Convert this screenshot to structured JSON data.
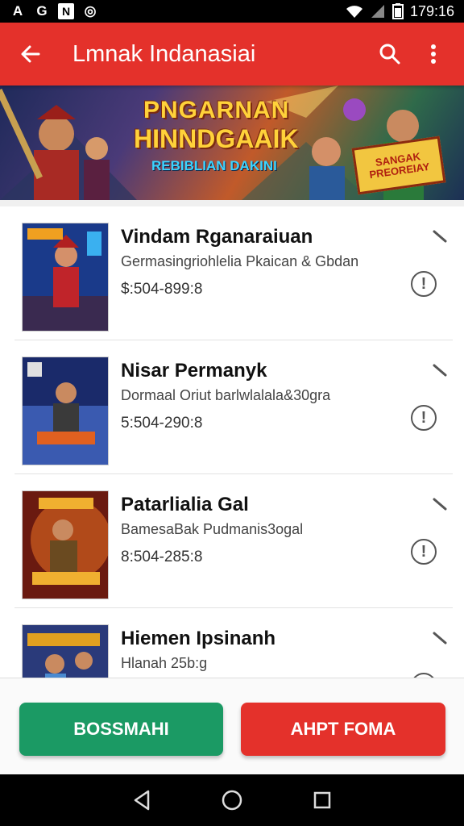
{
  "status_bar": {
    "left_icons": [
      "A",
      "G",
      "N",
      "◎"
    ],
    "time": "179:16"
  },
  "app_bar": {
    "title": "Lmnak Indanasiai",
    "icons": [
      "back-arrow-icon",
      "search-icon",
      "more-vert-icon"
    ]
  },
  "banner": {
    "line1": "PNGARNAN",
    "line2": "HINNDGAAIK",
    "line3": "REBIBLIAN DAKINI",
    "badge_line1": "SANGAK",
    "badge_line2": "PREOREIAY"
  },
  "games": [
    {
      "name": "Vindam Rganaraiuan",
      "subtitle": "Germasingriohlelia Pkaican & Gbdan",
      "meta": "$:504-899:8",
      "thumb_colors": [
        "#1a3a8a",
        "#c0242a",
        "#f0a020"
      ]
    },
    {
      "name": "Nisar Permanyk",
      "subtitle": "Dormaal Oriut barlwlalala&30gra",
      "meta": "5:504-290:8",
      "thumb_colors": [
        "#1a2a6a",
        "#3a5ab0",
        "#e06020"
      ]
    },
    {
      "name": "Patarlialia Gal",
      "subtitle": "BamesaBak Pudmanis3ogal",
      "meta": "8:504-285:8",
      "thumb_colors": [
        "#6a1a10",
        "#d06020",
        "#f0b030"
      ]
    },
    {
      "name": "Hiemen Ipsinanh",
      "subtitle": "Hlanah 25b:g",
      "meta": "",
      "thumb_colors": [
        "#2a3a7a",
        "#4a8ad0",
        "#e0a020"
      ]
    }
  ],
  "buttons": {
    "primary_label": "BOSSMAHI",
    "secondary_label": "AHPT FOMA"
  },
  "colors": {
    "app_bar": "#e4312b",
    "primary_button": "#1b9a64",
    "secondary_button": "#e4312b"
  }
}
